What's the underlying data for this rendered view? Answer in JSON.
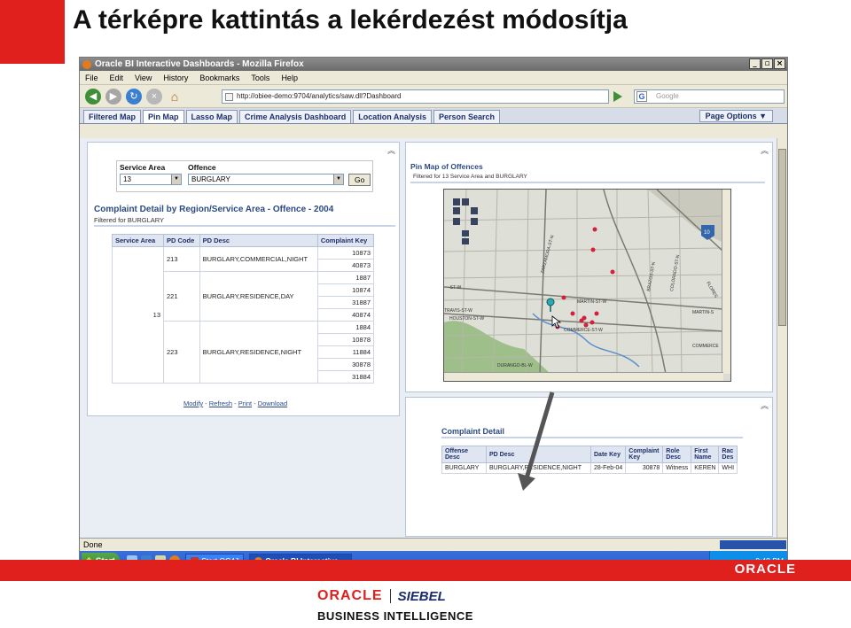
{
  "slide": {
    "title": "A térképre kattintás a lekérdezést módosítja",
    "footer_oracle": "ORACLE",
    "brand_oracle": "ORACLE",
    "brand_siebel": "SIEBEL",
    "brand_bi": "BUSINESS INTELLIGENCE"
  },
  "browser": {
    "title": "Oracle BI Interactive Dashboards - Mozilla Firefox",
    "menu": [
      "File",
      "Edit",
      "View",
      "History",
      "Bookmarks",
      "Tools",
      "Help"
    ],
    "url": "http://obiee-demo:9704/analytics/saw.dll?Dashboard",
    "search_placeholder": "Google",
    "status": "Done"
  },
  "tabs": [
    "Filtered Map",
    "Pin Map",
    "Lasso Map",
    "Crime Analysis Dashboard",
    "Location Analysis",
    "Person Search"
  ],
  "active_tab": "Pin Map",
  "page_options": "Page Options ▼",
  "prompt": {
    "service_area_label": "Service Area",
    "service_area_value": "13",
    "offence_label": "Offence",
    "offence_value": "BURGLARY",
    "go_label": "Go"
  },
  "complaint_report": {
    "title": "Complaint Detail by Region/Service Area - Offence - 2004",
    "subtitle": "Filtered for BURGLARY",
    "columns": [
      "Service Area",
      "PD Code",
      "PD Desc",
      "Complaint Key"
    ],
    "service_area": "13",
    "groups": [
      {
        "pd_code": "213",
        "pd_desc": "BURGLARY,COMMERCIAL,NIGHT",
        "keys": [
          "10873",
          "40873"
        ]
      },
      {
        "pd_code": "221",
        "pd_desc": "BURGLARY,RESIDENCE,DAY",
        "keys": [
          "1887",
          "10874",
          "31887",
          "40874"
        ]
      },
      {
        "pd_code": "223",
        "pd_desc": "BURGLARY,RESIDENCE,NIGHT",
        "keys": [
          "1884",
          "10878",
          "11884",
          "30878",
          "31884"
        ]
      }
    ],
    "links": [
      "Modify",
      "Refresh",
      "Print",
      "Download"
    ]
  },
  "pin_map": {
    "title": "Pin Map of Offences",
    "subtitle": "Filtered for 13 Service Area and BURGLARY",
    "street_labels": [
      "ZARZAMORA-ST-N",
      "BRAZOS-ST-N",
      "COLORADO-ST-N",
      "MARTIN-ST-W",
      "TRAVIS-ST-W",
      "HOUSTON-ST-W",
      "COMMERCE-ST-W",
      "DURANGO-BL-W",
      "MARTIN-S",
      "COMMERCE",
      "FLORES",
      "-ST-W"
    ],
    "highway": "10"
  },
  "complaint_detail": {
    "title": "Complaint Detail",
    "columns": [
      "Offense Desc",
      "PD Desc",
      "Date Key",
      "Complaint Key",
      "Role Desc",
      "First Name",
      "Rac Des"
    ],
    "rows": [
      [
        "BURGLARY",
        "BURGLARY,RESIDENCE,NIGHT",
        "28-Feb-04",
        "30878",
        "Witness",
        "KEREN",
        "WHI"
      ]
    ]
  },
  "taskbar": {
    "start": "Start",
    "tasks": [
      "Start OC4J",
      "Oracle BI Interactive ..."
    ],
    "clock": "9:48 PM"
  },
  "colors": {
    "brand_red": "#e0201c",
    "header_blue": "#2c4a86",
    "pin": "#d4213b"
  }
}
